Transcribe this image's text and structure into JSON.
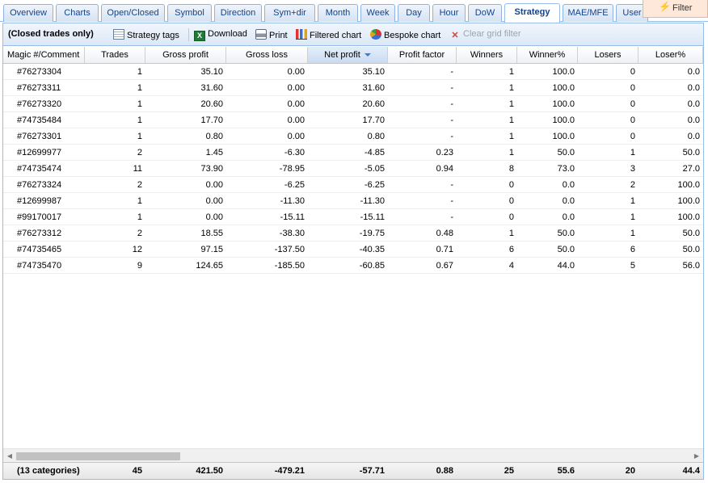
{
  "tabs": [
    "Overview",
    "Charts",
    "Open/Closed",
    "Symbol",
    "Direction",
    "Sym+dir",
    "Month",
    "Week",
    "Day",
    "Hour",
    "DoW",
    "Strategy",
    "MAE/MFE",
    "User"
  ],
  "active_tab": "Strategy",
  "filter_label": "Filter",
  "toolbar": {
    "caption": "(Closed trades only)",
    "strategy_tags": "Strategy tags",
    "download": "Download",
    "print": "Print",
    "filtered_chart": "Filtered chart",
    "bespoke_chart": "Bespoke chart",
    "clear_filter": "Clear grid filter"
  },
  "columns": [
    "Magic #/Comment",
    "Trades",
    "Gross profit",
    "Gross loss",
    "Net profit",
    "Profit factor",
    "Winners",
    "Winner%",
    "Losers",
    "Loser%"
  ],
  "sorted_column": "Net profit",
  "rows": [
    [
      "#76273304",
      "1",
      "35.10",
      "0.00",
      "35.10",
      "-",
      "1",
      "100.0",
      "0",
      "0.0"
    ],
    [
      "#76273311",
      "1",
      "31.60",
      "0.00",
      "31.60",
      "-",
      "1",
      "100.0",
      "0",
      "0.0"
    ],
    [
      "#76273320",
      "1",
      "20.60",
      "0.00",
      "20.60",
      "-",
      "1",
      "100.0",
      "0",
      "0.0"
    ],
    [
      "#74735484",
      "1",
      "17.70",
      "0.00",
      "17.70",
      "-",
      "1",
      "100.0",
      "0",
      "0.0"
    ],
    [
      "#76273301",
      "1",
      "0.80",
      "0.00",
      "0.80",
      "-",
      "1",
      "100.0",
      "0",
      "0.0"
    ],
    [
      "#12699977",
      "2",
      "1.45",
      "-6.30",
      "-4.85",
      "0.23",
      "1",
      "50.0",
      "1",
      "50.0"
    ],
    [
      "#74735474",
      "11",
      "73.90",
      "-78.95",
      "-5.05",
      "0.94",
      "8",
      "73.0",
      "3",
      "27.0"
    ],
    [
      "#76273324",
      "2",
      "0.00",
      "-6.25",
      "-6.25",
      "-",
      "0",
      "0.0",
      "2",
      "100.0"
    ],
    [
      "#12699987",
      "1",
      "0.00",
      "-11.30",
      "-11.30",
      "-",
      "0",
      "0.0",
      "1",
      "100.0"
    ],
    [
      "#99170017",
      "1",
      "0.00",
      "-15.11",
      "-15.11",
      "-",
      "0",
      "0.0",
      "1",
      "100.0"
    ],
    [
      "#76273312",
      "2",
      "18.55",
      "-38.30",
      "-19.75",
      "0.48",
      "1",
      "50.0",
      "1",
      "50.0"
    ],
    [
      "#74735465",
      "12",
      "97.15",
      "-137.50",
      "-40.35",
      "0.71",
      "6",
      "50.0",
      "6",
      "50.0"
    ],
    [
      "#74735470",
      "9",
      "124.65",
      "-185.50",
      "-60.85",
      "0.67",
      "4",
      "44.0",
      "5",
      "56.0"
    ]
  ],
  "footer": [
    "(13 categories)",
    "45",
    "421.50",
    "-479.21",
    "-57.71",
    "0.88",
    "25",
    "55.6",
    "20",
    "44.4"
  ],
  "icons": {
    "strategy_tags": "list-icon",
    "download": "excel-icon",
    "print": "printer-icon",
    "filtered_chart": "bar-chart-icon",
    "bespoke_chart": "pie-chart-icon",
    "clear_filter": "clear-filter-icon",
    "filter": "filter-icon"
  }
}
